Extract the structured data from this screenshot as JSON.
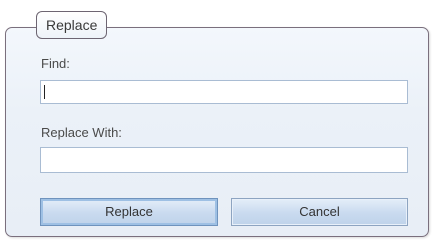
{
  "dialog": {
    "title": "Replace",
    "find": {
      "label": "Find:",
      "value": ""
    },
    "replace_with": {
      "label": "Replace With:",
      "value": ""
    },
    "buttons": {
      "replace": "Replace",
      "cancel": "Cancel"
    }
  }
}
